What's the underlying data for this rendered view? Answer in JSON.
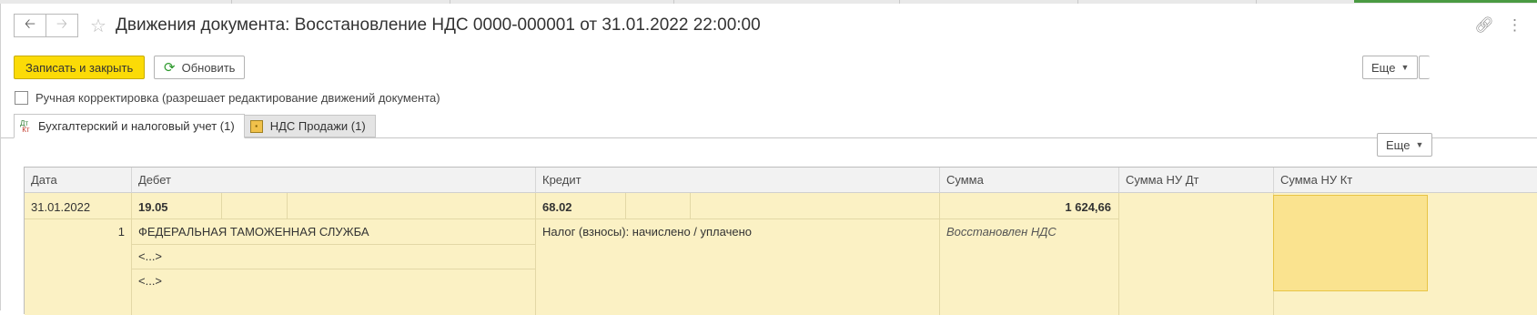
{
  "window": {
    "title": "Движения документа: Восстановление НДС 0000-000001 от 31.01.2022 22:00:00",
    "back_icon": "arrow-left",
    "forward_icon": "arrow-right",
    "favorite_icon": "star",
    "link_icon": "link",
    "menu_icon": "more-vertical"
  },
  "toolbar": {
    "save_close_label": "Записать и закрыть",
    "refresh_label": "Обновить",
    "refresh_icon": "refresh",
    "more_label": "Еще"
  },
  "manual_correction": {
    "label": "Ручная корректировка (разрешает редактирование движений документа)",
    "checked": false
  },
  "tabs": [
    {
      "label": "Бухгалтерский и налоговый учет (1)",
      "active": true,
      "icon": "dt-kt"
    },
    {
      "label": "НДС Продажи (1)",
      "active": false,
      "icon": "document"
    }
  ],
  "table": {
    "more_label": "Еще",
    "columns": [
      "Дата",
      "Дебет",
      "Кредит",
      "Сумма",
      "Сумма НУ Дт",
      "Сумма НУ Кт"
    ],
    "rows": [
      {
        "date": "31.01.2022",
        "number": "1",
        "debit_account": "19.05",
        "debit_subconto": [
          "ФЕДЕРАЛЬНАЯ ТАМОЖЕННАЯ СЛУЖБА",
          "<...>",
          "<...>"
        ],
        "credit_account": "68.02",
        "credit_subconto": [
          "Налог (взносы): начислено / уплачено"
        ],
        "amount": "1 624,66",
        "content": "Восстановлен НДС",
        "amount_nu_dt": "",
        "amount_nu_kt": ""
      }
    ]
  },
  "colors": {
    "primary_button": "#fbdb07",
    "row_background": "#fbf1c4",
    "selected_cell": "#fae38f",
    "accent_green": "#4a9a42"
  }
}
